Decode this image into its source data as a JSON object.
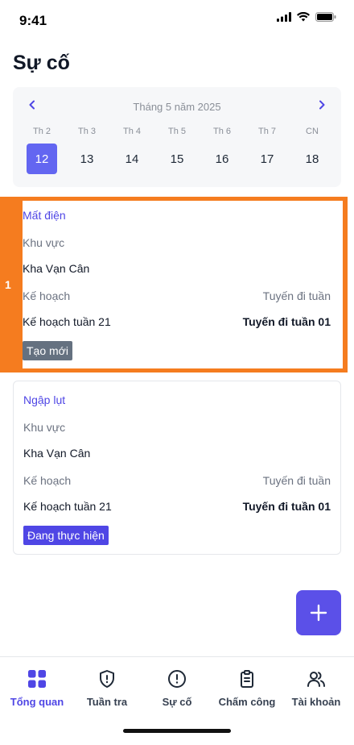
{
  "status_bar": {
    "time": "9:41"
  },
  "page": {
    "title": "Sự cố"
  },
  "calendar": {
    "month_label": "Tháng 5 năm 2025",
    "weekdays": [
      "Th 2",
      "Th 3",
      "Th 4",
      "Th 5",
      "Th 6",
      "Th 7",
      "CN"
    ],
    "days": [
      "12",
      "13",
      "14",
      "15",
      "16",
      "17",
      "18"
    ],
    "selected_day": "12"
  },
  "incidents": [
    {
      "title": "Mất điện",
      "area_label": "Khu vực",
      "area_value": "Kha Vạn Cân",
      "plan_label": "Kế hoạch",
      "route_label": "Tuyến đi tuần",
      "plan_value": "Kế hoạch tuần 21",
      "route_value": "Tuyến đi tuần 01",
      "status": "Tạo mới",
      "status_color": "#657180"
    },
    {
      "title": "Ngập lụt",
      "area_label": "Khu vực",
      "area_value": "Kha Vạn Cân",
      "plan_label": "Kế hoạch",
      "route_label": "Tuyến đi tuần",
      "plan_value": "Kế hoạch tuần 21",
      "route_value": "Tuyến đi tuần 01",
      "status": "Đang thực hiện",
      "status_color": "#4f46e5"
    }
  ],
  "highlight": {
    "number": "1",
    "color": "#f57c1f"
  },
  "bottom_nav": {
    "items": [
      {
        "label": "Tổng quan",
        "icon": "grid-icon",
        "active": true
      },
      {
        "label": "Tuần tra",
        "icon": "shield-alert-icon",
        "active": false
      },
      {
        "label": "Sự cố",
        "icon": "alert-circle-icon",
        "active": false
      },
      {
        "label": "Chấm công",
        "icon": "clipboard-icon",
        "active": false
      },
      {
        "label": "Tài khoản",
        "icon": "users-icon",
        "active": false
      }
    ]
  },
  "colors": {
    "accent": "#4f46e5",
    "fab": "#5b50e8"
  }
}
